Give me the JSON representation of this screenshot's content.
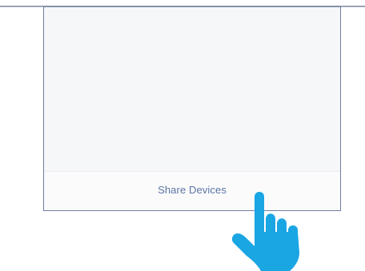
{
  "panel": {
    "share_button_label": "Share Devices"
  },
  "pointer": {
    "icon": "tap-hand-icon",
    "color": "#1aa5e3"
  }
}
